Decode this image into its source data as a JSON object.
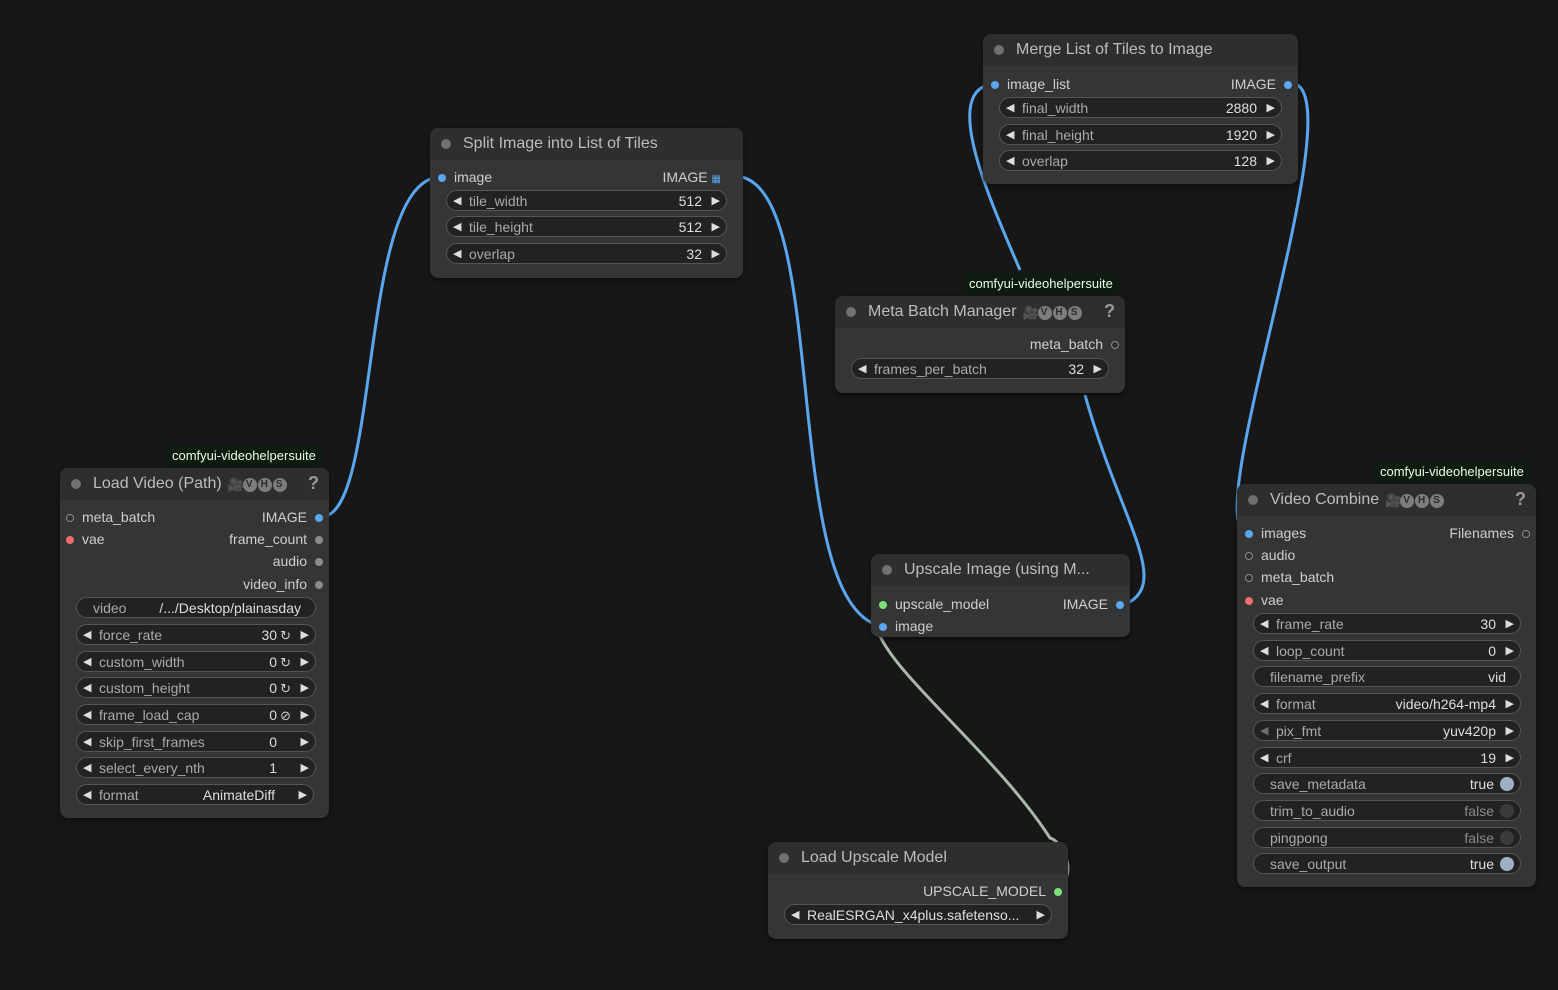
{
  "tag": "comfyui-videohelpersuite",
  "vhs_letters": [
    "V",
    "H",
    "S"
  ],
  "help_mark": "?",
  "load_video": {
    "title": "Load Video (Path)",
    "inputs": [
      "meta_batch",
      "vae"
    ],
    "outputs": [
      "IMAGE",
      "frame_count",
      "audio",
      "video_info"
    ],
    "widgets": [
      {
        "label": "video",
        "value": "/.../Desktop/plainasday"
      },
      {
        "label": "force_rate",
        "value": "30"
      },
      {
        "label": "custom_width",
        "value": "0"
      },
      {
        "label": "custom_height",
        "value": "0"
      },
      {
        "label": "frame_load_cap",
        "value": "0"
      },
      {
        "label": "skip_first_frames",
        "value": "0"
      },
      {
        "label": "select_every_nth",
        "value": "1"
      },
      {
        "label": "format",
        "value": "AnimateDiff"
      }
    ]
  },
  "split": {
    "title": "Split Image into List of Tiles",
    "inputs": [
      "image"
    ],
    "outputs": [
      "IMAGE"
    ],
    "widgets": [
      {
        "label": "tile_width",
        "value": "512"
      },
      {
        "label": "tile_height",
        "value": "512"
      },
      {
        "label": "overlap",
        "value": "32"
      }
    ]
  },
  "merge": {
    "title": "Merge List of Tiles to Image",
    "inputs": [
      "image_list"
    ],
    "outputs": [
      "IMAGE"
    ],
    "widgets": [
      {
        "label": "final_width",
        "value": "2880"
      },
      {
        "label": "final_height",
        "value": "1920"
      },
      {
        "label": "overlap",
        "value": "128"
      }
    ]
  },
  "meta_batch": {
    "title": "Meta Batch Manager",
    "outputs": [
      "meta_batch"
    ],
    "widgets": [
      {
        "label": "frames_per_batch",
        "value": "32"
      }
    ]
  },
  "upscale": {
    "title": "Upscale Image (using M...",
    "inputs": [
      "upscale_model",
      "image"
    ],
    "outputs": [
      "IMAGE"
    ]
  },
  "load_upscale": {
    "title": "Load Upscale Model",
    "outputs": [
      "UPSCALE_MODEL"
    ],
    "widgets": [
      {
        "label": "",
        "value": "RealESRGAN_x4plus.safetenso..."
      }
    ]
  },
  "video_combine": {
    "title": "Video Combine",
    "inputs": [
      "images",
      "audio",
      "meta_batch",
      "vae"
    ],
    "outputs": [
      "Filenames"
    ],
    "widgets": [
      {
        "label": "frame_rate",
        "value": "30"
      },
      {
        "label": "loop_count",
        "value": "0"
      },
      {
        "label": "filename_prefix",
        "value": "vid"
      },
      {
        "label": "format",
        "value": "video/h264-mp4"
      },
      {
        "label": "pix_fmt",
        "value": "yuv420p"
      },
      {
        "label": "crf",
        "value": "19"
      },
      {
        "label": "save_metadata",
        "value": "true"
      },
      {
        "label": "trim_to_audio",
        "value": "false"
      },
      {
        "label": "pingpong",
        "value": "false"
      },
      {
        "label": "save_output",
        "value": "true"
      }
    ]
  },
  "colors": {
    "link_image": "#5aa7ee",
    "link_model": "#a9b8a8",
    "canvas": "#171717",
    "node": "#353535"
  }
}
